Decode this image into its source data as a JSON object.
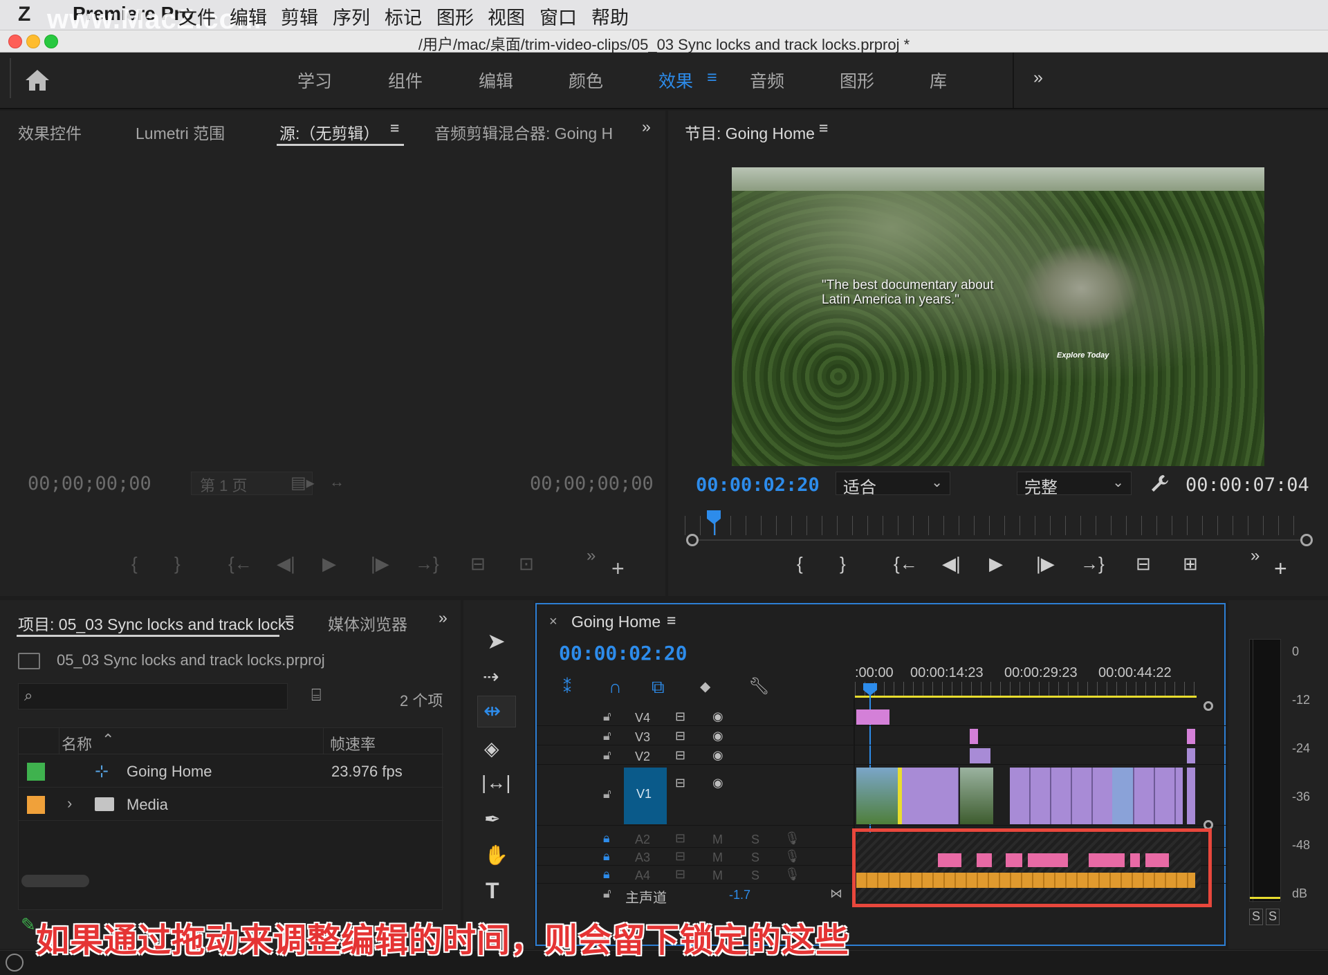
{
  "menubar": {
    "watermark": "www.MacZ.com",
    "app_name": "Premiere Pro",
    "items": [
      "文件",
      "编辑",
      "剪辑",
      "序列",
      "标记",
      "图形",
      "视图",
      "窗口",
      "帮助"
    ]
  },
  "titlebar": {
    "title": "/用户/mac/桌面/trim-video-clips/05_03 Sync locks and track locks.prproj *"
  },
  "workspaces": {
    "tabs": [
      "学习",
      "组件",
      "编辑",
      "颜色",
      "效果",
      "音频",
      "图形",
      "库"
    ],
    "active": "效果",
    "more": "»"
  },
  "source_panel": {
    "tabs": [
      "效果控件",
      "Lumetri 范围",
      "源:（无剪辑）",
      "音频剪辑混合器: Going H"
    ],
    "timecode_left": "00;00;00;00",
    "timecode_right": "00;00;00;00",
    "page_label": "第 1 页"
  },
  "program_panel": {
    "title": "节目: Going Home",
    "timecode_current": "00:00:02:20",
    "fit_label": "适合",
    "quality_label": "完整",
    "timecode_duration": "00:00:07:04",
    "video_quote_line1": "\"The best documentary about",
    "video_quote_line2": "Latin America in years.\"",
    "video_logo": "Explore Today"
  },
  "project_panel": {
    "tab": "项目: 05_03 Sync locks and track locks",
    "tab2": "媒体浏览器",
    "file_name": "05_03 Sync locks and track locks.prproj",
    "item_count": "2 个项",
    "col_name": "名称",
    "col_fps": "帧速率",
    "rows": [
      {
        "name": "Going Home",
        "fps": "23.976 fps",
        "color": "#3fb24e"
      },
      {
        "name": "Media",
        "fps": "",
        "color": "#f0a13a"
      }
    ]
  },
  "timeline_panel": {
    "title": "Going Home",
    "timecode": "00:00:02:20",
    "ruler": [
      ":00:00",
      "00:00:14:23",
      "00:00:29:23",
      "00:00:44:22"
    ],
    "video_tracks": [
      "V4",
      "V3",
      "V2",
      "V1"
    ],
    "audio_tracks": [
      "A2",
      "A3",
      "A4"
    ],
    "master_label": "主声道",
    "master_value": "-1.7"
  },
  "meter": {
    "labels": [
      "0",
      "-12",
      "-24",
      "-36",
      "-48",
      "dB"
    ],
    "solo": [
      "S",
      "S"
    ]
  },
  "caption": "如果通过拖动来调整编辑的时间，则会留下锁定的这些",
  "colors": {
    "accent": "#2d8ceb",
    "highlight_box": "#e8473c",
    "video_clip": "#a88bd6",
    "audio_clip": "#e86aa5",
    "audio_master": "#e09a2e"
  }
}
